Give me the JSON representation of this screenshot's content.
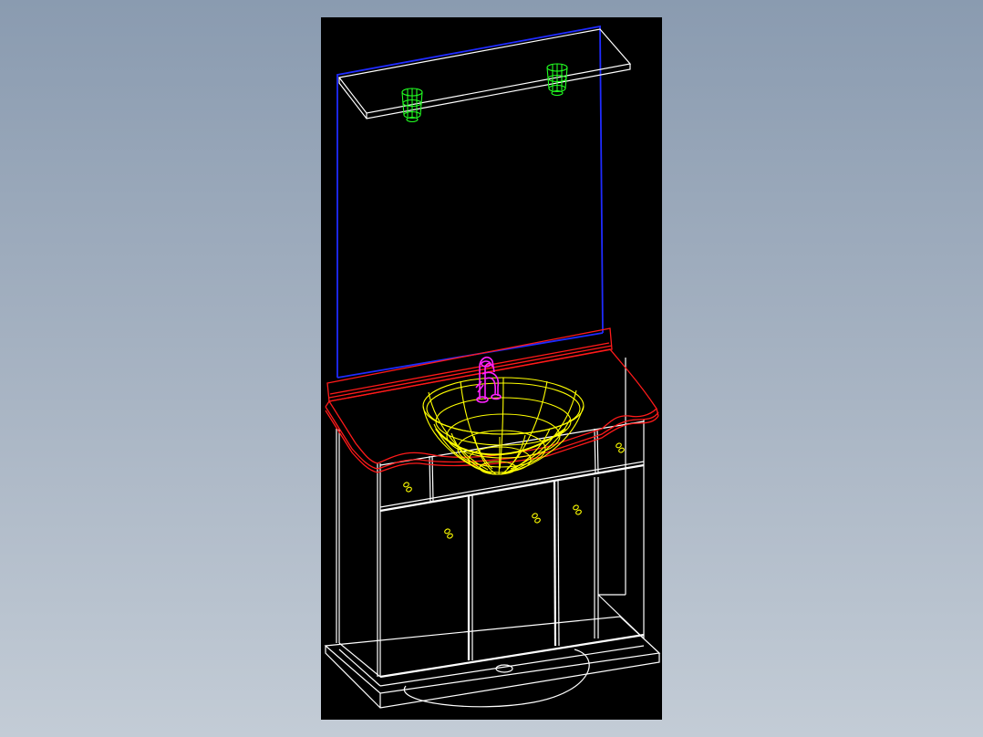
{
  "colors": {
    "background_top": "#8a9bb0",
    "background_bottom": "#c3ccd6",
    "canvas": "#000000",
    "cabinet": "#ffffff",
    "countertop": "#ff1a1a",
    "mirror": "#1f2bff",
    "lights": "#22ff22",
    "basin": "#ffff00",
    "faucet": "#ff22ff"
  }
}
